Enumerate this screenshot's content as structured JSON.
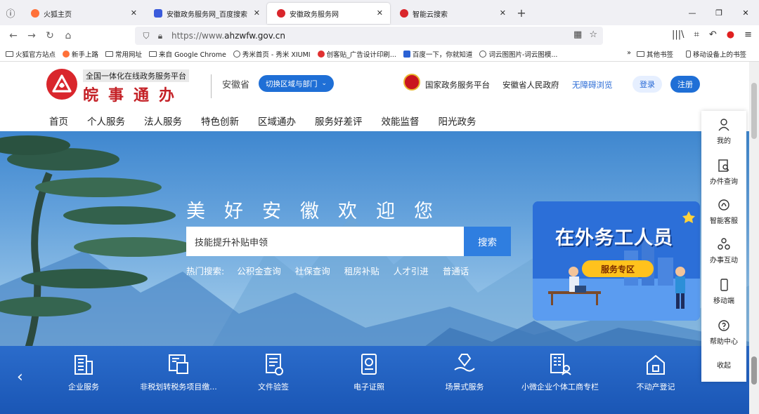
{
  "browser": {
    "tabs": [
      {
        "title": "火狐主页",
        "favicon_color": "#ff7139",
        "active": false
      },
      {
        "title": "安徽政务服务网_百度搜索",
        "favicon_color": "#3b5bdb",
        "active": false
      },
      {
        "title": "安徽政务服务网",
        "favicon_color": "#d9262c",
        "active": true
      },
      {
        "title": "智能云搜索",
        "favicon_color": "#d9262c",
        "active": false
      }
    ],
    "url_prefix": "https://www.",
    "url_domain": "ahzwfw.gov.cn",
    "bookmarks": [
      "火狐官方站点",
      "新手上路",
      "常用网址",
      "来自 Google Chrome",
      "秀米首页 - 秀米 XIUMI",
      "创客贴_广告设计印刷...",
      "百度一下，你就知道",
      "词云图图片-词云图模..."
    ],
    "bookmarks_right": [
      "其他书签",
      "移动设备上的书签"
    ]
  },
  "site": {
    "slogan": "全国一体化在线政务服务平台",
    "brand": "皖事通办",
    "province": "安徽省",
    "switch_label": "切换区域与部门",
    "links": [
      "国家政务服务平台",
      "安徽省人民政府",
      "无障碍浏览"
    ],
    "login": "登录",
    "register": "注册",
    "nav": [
      "首页",
      "个人服务",
      "法人服务",
      "特色创新",
      "区域通办",
      "服务好差评",
      "效能监督",
      "阳光政务"
    ]
  },
  "hero": {
    "welcome": "美好安徽欢迎您",
    "search_value": "技能提升补贴申领",
    "search_button": "搜索",
    "hot_label": "热门搜索:",
    "hot_items": [
      "公积金查询",
      "社保查询",
      "租房补贴",
      "人才引进",
      "普通话"
    ]
  },
  "banner": {
    "title": "在外务工人员",
    "pill": "服务专区"
  },
  "services": [
    {
      "label": "企业服务",
      "icon": "enterprise-icon"
    },
    {
      "label": "非税划转税务项目缴...",
      "icon": "tax-icon"
    },
    {
      "label": "文件验签",
      "icon": "document-icon"
    },
    {
      "label": "电子证照",
      "icon": "certificate-icon"
    },
    {
      "label": "场景式服务",
      "icon": "scene-icon"
    },
    {
      "label": "小微企业个体工商专栏",
      "icon": "small-business-icon"
    },
    {
      "label": "不动产登记",
      "icon": "property-icon"
    }
  ],
  "dock": {
    "items": [
      {
        "label": "我的",
        "icon": "user-icon"
      },
      {
        "label": "办件查询",
        "icon": "query-icon"
      },
      {
        "label": "智能客服",
        "icon": "service-icon"
      },
      {
        "label": "办事互动",
        "icon": "interact-icon"
      },
      {
        "label": "移动端",
        "icon": "mobile-icon"
      },
      {
        "label": "帮助中心",
        "icon": "help-icon"
      }
    ],
    "collapse": "收起"
  }
}
